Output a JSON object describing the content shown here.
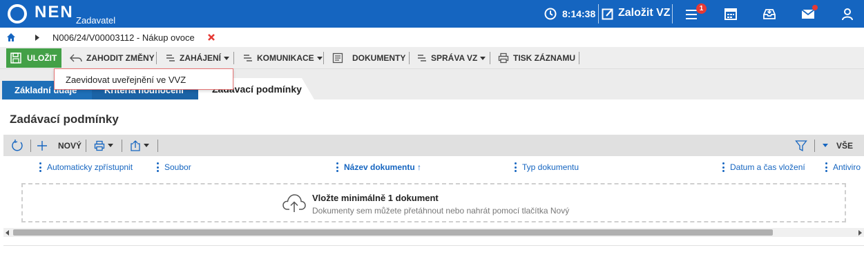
{
  "header": {
    "logo_text": "NEN",
    "logo_subtitle": "Zadavatel",
    "time": "8:14:38",
    "create_label": "Založit VZ",
    "notification_count": "1",
    "icons": [
      "clock-icon",
      "edit-icon",
      "menu-icon",
      "calendar-icon",
      "inbox-icon",
      "mail-icon",
      "user-icon"
    ],
    "brand_color": "#1565c0"
  },
  "breadcrumb": {
    "text": "N006/24/V00003112 - Nákup ovoce"
  },
  "toolbar": {
    "save": "ULOŽIT",
    "discard": "ZAHODIT ZMĚNY",
    "start": "ZAHÁJENÍ",
    "communication": "KOMUNIKACE",
    "documents": "DOKUMENTY",
    "management": "SPRÁVA VZ",
    "print": "TISK ZÁZNAMU",
    "save_color": "#43a047"
  },
  "dropdown": {
    "items": [
      "Zaevidovat uveřejnění ve VVZ"
    ]
  },
  "tabs": [
    {
      "label": "Základní údaje"
    },
    {
      "label": "Kritéria hodnocení"
    },
    {
      "label": "Zadávací podmínky",
      "active": true
    }
  ],
  "section": {
    "title": "Zadávací podmínky"
  },
  "grid_toolbar": {
    "new_label": "NOVÝ",
    "filter_all": "VŠE"
  },
  "columns": [
    {
      "label": "Automaticky zpřístupnit"
    },
    {
      "label": "Soubor"
    },
    {
      "label": "Název dokumentu ↑"
    },
    {
      "label": "Typ dokumentu"
    },
    {
      "label": "Datum a čas vložení"
    },
    {
      "label": "Antiviro"
    }
  ],
  "dropzone": {
    "title": "Vložte minimálně 1 dokument",
    "subtitle": "Dokumenty sem můžete přetáhnout nebo nahrát pomocí tlačítka Nový"
  }
}
